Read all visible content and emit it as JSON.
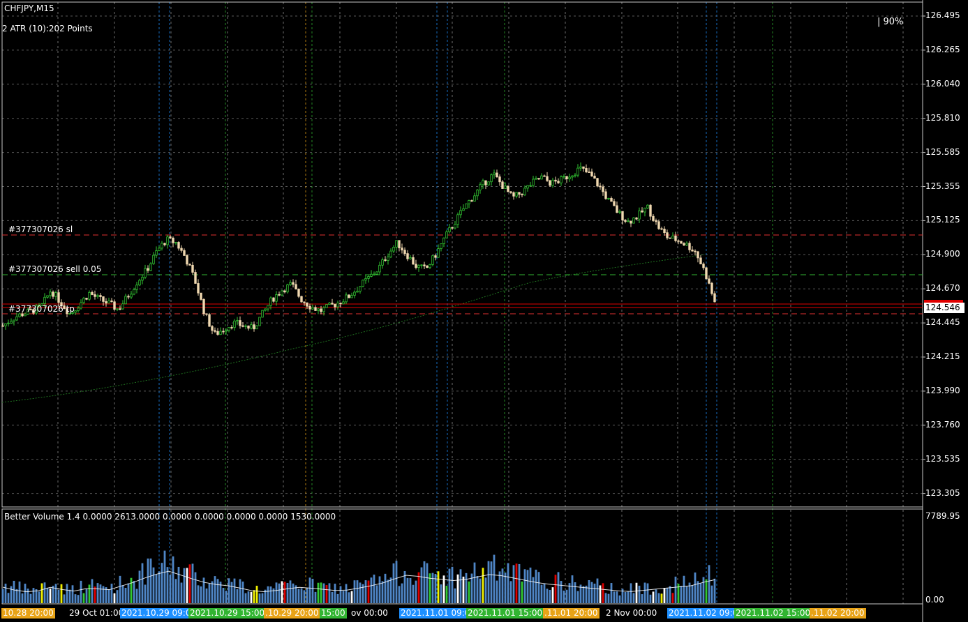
{
  "header": {
    "symbol": "CHFJPY,M15",
    "atr": "2 ATR (10):202 Points",
    "percent": "| 90%"
  },
  "price_axis": {
    "labels": [
      "126.495",
      "126.265",
      "126.040",
      "125.810",
      "125.585",
      "125.355",
      "125.125",
      "124.900",
      "124.670",
      "124.445",
      "124.215",
      "123.990",
      "123.760",
      "123.535",
      "123.305"
    ],
    "current_price": "124.546"
  },
  "orders": {
    "sl_label": "#377307026 sl",
    "entry_label": "#377307026 sell 0.05",
    "tp_label": "#377307026 tp"
  },
  "volume_panel": {
    "title": "Better Volume 1.4 0.0000 2613.0000 0.0000 0.0000 0.0000 0.0000 1530.0000",
    "top_label": "7789.95",
    "bottom_label": "0.00"
  },
  "time_axis": {
    "labels": [
      {
        "text": "10.28 20:00",
        "bg": "#e8a317"
      },
      {
        "text": "29 Oct 01:00",
        "bg": ""
      },
      {
        "text": "2021.10.29 09:0",
        "bg": "#1e90ff"
      },
      {
        "text": "2021.10.29 15:00",
        "bg": "#32b432"
      },
      {
        "text": ".10.29 20:00",
        "bg": "#e8a317"
      },
      {
        "text": "15:00",
        "bg": "#32b432"
      },
      {
        "text": "ov 00:00",
        "bg": ""
      },
      {
        "text": "2021.11.01 09:0",
        "bg": "#1e90ff"
      },
      {
        "text": "2021.11.01 15:00",
        "bg": "#32b432"
      },
      {
        "text": ".11.01 20:00",
        "bg": "#e8a317"
      },
      {
        "text": "2 Nov 00:00",
        "bg": ""
      },
      {
        "text": "2021.11.02 09:0",
        "bg": "#1e90ff"
      },
      {
        "text": "2021.11.02 15:00",
        "bg": "#32b432"
      },
      {
        "text": ".11.02 20:00",
        "bg": "#e8a317"
      }
    ]
  },
  "colors": {
    "bull": "#32c832",
    "bear": "#f0d8b0",
    "grid": "#c8c8c8",
    "session_blue": "#1e90ff",
    "session_green": "#32b432",
    "session_yellow": "#e8a317",
    "sl_line": "#e03030",
    "entry_line": "#32b432",
    "price_line": "#e00000",
    "ma": "#1f6f1f",
    "vol_blue": "#4f86c6",
    "vol_red": "#e00000",
    "vol_green": "#32c832",
    "vol_white": "#ffffff",
    "vol_yellow": "#f0f000"
  },
  "chart_data": {
    "type": "candlestick",
    "price_path": [
      124.42,
      124.47,
      124.5,
      124.52,
      124.55,
      124.66,
      124.58,
      124.5,
      124.57,
      124.64,
      124.6,
      124.57,
      124.53,
      124.62,
      124.72,
      124.8,
      124.92,
      125.0,
      124.98,
      124.88,
      124.72,
      124.5,
      124.36,
      124.4,
      124.44,
      124.42,
      124.4,
      124.5,
      124.6,
      124.66,
      124.7,
      124.6,
      124.55,
      124.52,
      124.55,
      124.58,
      124.62,
      124.68,
      124.74,
      124.8,
      124.9,
      124.98,
      124.9,
      124.82,
      124.8,
      124.9,
      125.02,
      125.12,
      125.22,
      125.3,
      125.38,
      125.44,
      125.36,
      125.28,
      125.32,
      125.38,
      125.42,
      125.38,
      125.4,
      125.44,
      125.48,
      125.44,
      125.36,
      125.26,
      125.18,
      125.12,
      125.16,
      125.22,
      125.1,
      125.02,
      125.0,
      124.97,
      124.92,
      124.78,
      124.58
    ],
    "volume_path": [
      1800,
      1500,
      1400,
      1200,
      1500,
      1800,
      1600,
      1300,
      1500,
      1700,
      1600,
      1500,
      1800,
      2200,
      2400,
      2900,
      3200,
      3600,
      3300,
      2900,
      2600,
      2300,
      2100,
      2000,
      1900,
      1600,
      1400,
      1300,
      1400,
      1500,
      1700,
      1800,
      1700,
      1600,
      1500,
      1400,
      1500,
      1700,
      1900,
      2100,
      2400,
      2800,
      3100,
      3000,
      2800,
      2700,
      2600,
      2500,
      2600,
      2800,
      3100,
      3200,
      3000,
      2800,
      2600,
      2400,
      2200,
      2100,
      2000,
      1900,
      1800,
      1700,
      1600,
      1500,
      1400,
      1300,
      1400,
      1500,
      1600,
      1700,
      1800,
      1900,
      2000,
      2400,
      2600
    ],
    "price_ylim": [
      123.2,
      126.6
    ],
    "volume_ylim": [
      0,
      7789.95
    ]
  }
}
